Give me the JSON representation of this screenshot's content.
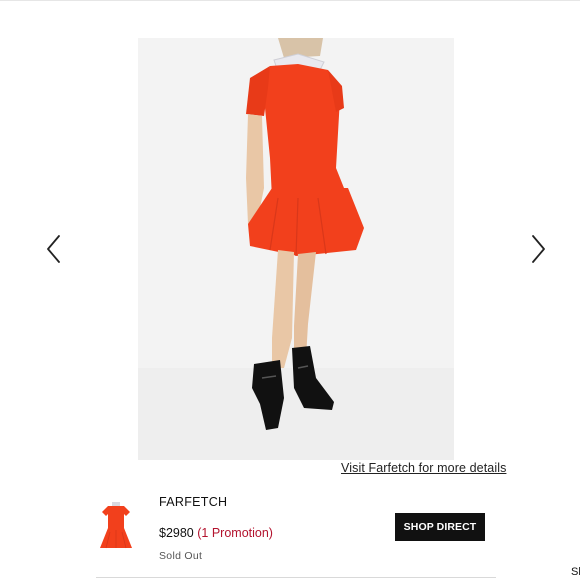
{
  "gallery": {
    "prev_icon": "chevron-left-icon",
    "next_icon": "chevron-right-icon",
    "image_alt": "product photo",
    "details_link": "Visit Farfetch for more details"
  },
  "offer": {
    "retailer": "FARFETCH",
    "price": "$2980",
    "promotion": "(1 Promotion)",
    "status": "Sold Out",
    "shop_button": "SHOP DIRECT",
    "colors": {
      "promotion": "#b3122d",
      "button_bg": "#111111",
      "product": "#f2401c"
    }
  },
  "cutoff_text": "Sh"
}
